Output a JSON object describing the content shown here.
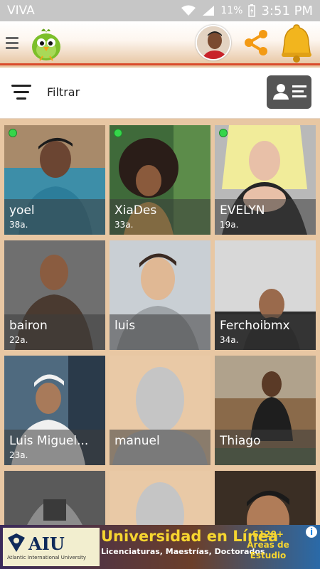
{
  "status_bar": {
    "carrier": "VIVA",
    "battery": "11%",
    "time": "3:51 PM"
  },
  "header": {
    "logo_icon": "green-bird-logo",
    "menu_icon": "hamburger",
    "share_icon": "share",
    "bell_icon": "bell"
  },
  "filter_bar": {
    "label": "Filtrar",
    "filter_icon": "filter-lines",
    "contact_icon": "contact-card"
  },
  "profiles": [
    {
      "name": "yoel",
      "age": "38a.",
      "online": true
    },
    {
      "name": "XiaDes",
      "age": "33a.",
      "online": true
    },
    {
      "name": "EVELYN",
      "age": "19a.",
      "online": true
    },
    {
      "name": "bairon",
      "age": "22a.",
      "online": false
    },
    {
      "name": "luis",
      "age": "",
      "online": false
    },
    {
      "name": "Ferchoibmx",
      "age": "34a.",
      "online": false
    },
    {
      "name": "Luis Miguel...",
      "age": "23a.",
      "online": false
    },
    {
      "name": "manuel",
      "age": "",
      "online": false
    },
    {
      "name": "Thiago",
      "age": "",
      "online": false
    },
    {
      "name": "",
      "age": "",
      "online": false
    },
    {
      "name": "",
      "age": "",
      "online": false
    },
    {
      "name": "",
      "age": "",
      "online": false
    }
  ],
  "ad": {
    "logo": "AIU",
    "logo_sub": "Atlantic International University",
    "title": "Universidad en Línea",
    "subtitle": "Licenciaturas, Maestrías, Doctorados",
    "side": "S120+ Áreas de Estudio",
    "info": "i"
  },
  "colors": {
    "accent": "#d94a2b",
    "background": "#e8c7a3",
    "online": "#35d64a"
  }
}
